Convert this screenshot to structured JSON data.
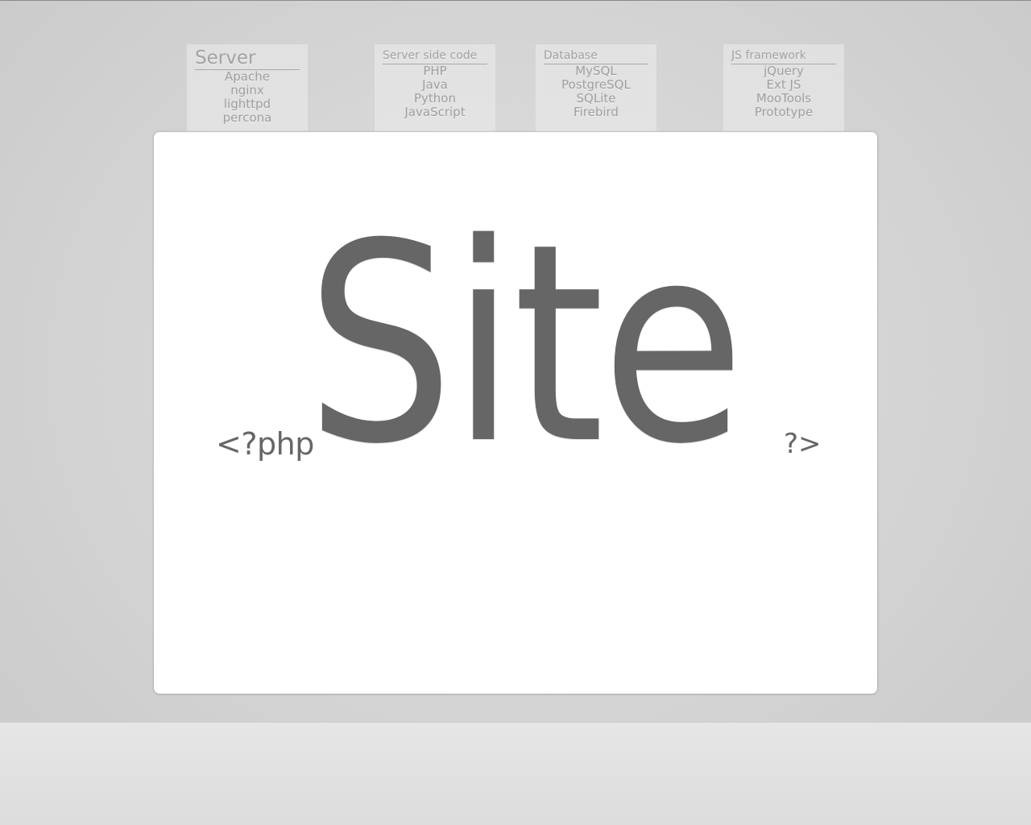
{
  "tabs": [
    {
      "title": "Server",
      "items": [
        "Apache",
        "nginx",
        "lighttpd",
        "percona"
      ]
    },
    {
      "title": "Server side code",
      "items": [
        "PHP",
        "Java",
        "Python",
        "JavaScript"
      ]
    },
    {
      "title": "Database",
      "items": [
        "MySQL",
        "PostgreSQL",
        "SQLite",
        "Firebird"
      ]
    },
    {
      "title": "JS framework",
      "items": [
        "jQuery",
        "Ext JS",
        "MooTools",
        "Prototype"
      ]
    }
  ],
  "hero": {
    "open_tag": "<?php",
    "word": "Site",
    "close_tag": "?>"
  }
}
